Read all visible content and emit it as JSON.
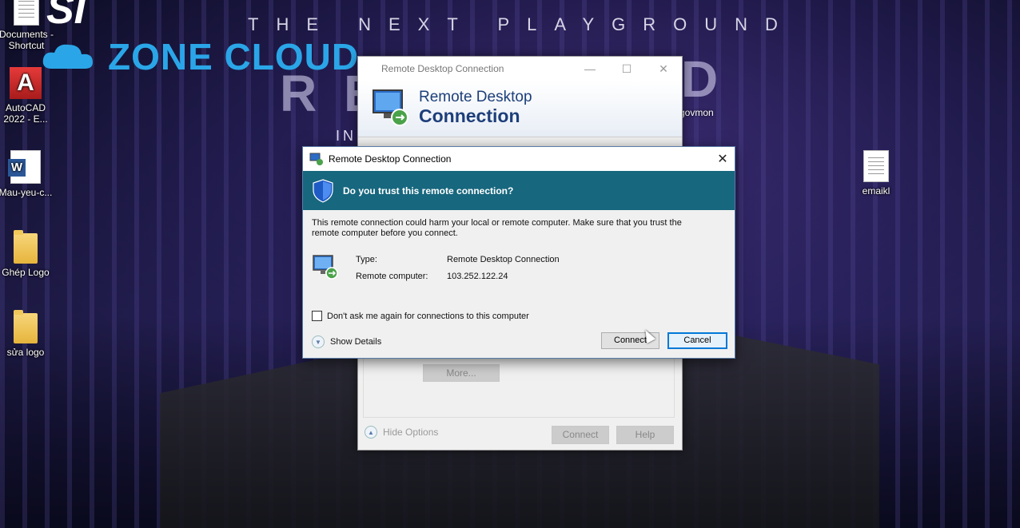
{
  "wallpaper": {
    "tagline": "THE NEXT PLAYGROUND",
    "brand_overlay": "ZONE CLOUD",
    "msi_logo": "SI",
    "big_letters": "R E",
    "big_letter_d": "D",
    "in_text": "IN",
    "govmon_label": "govmon"
  },
  "desktop_icons": [
    {
      "label": "Documents - Shortcut",
      "icon": "document-shortcut-icon"
    },
    {
      "label": "AutoCAD 2022 - E...",
      "icon": "autocad-icon"
    },
    {
      "label": "Mau-yeu-c...",
      "icon": "word-document-icon"
    },
    {
      "label": "Ghép Logo",
      "icon": "folder-icon"
    },
    {
      "label": "sửa logo",
      "icon": "folder-icon"
    },
    {
      "label": "emaikl",
      "icon": "text-file-icon"
    }
  ],
  "back_window": {
    "title": "Remote Desktop Connection",
    "header_line1": "Remote Desktop",
    "header_line2": "Connection",
    "more_button": "More...",
    "hide_options": "Hide Options",
    "connect_button": "Connect",
    "help_button": "Help",
    "minimize_glyph": "—",
    "maximize_glyph": "☐",
    "close_glyph": "✕"
  },
  "dialog": {
    "title": "Remote Desktop Connection",
    "close_glyph": "✕",
    "banner_text": "Do you trust this remote connection?",
    "warning": "This remote connection could harm your local or remote computer. Make sure that you trust the remote computer before you connect.",
    "type_label": "Type:",
    "type_value": "Remote Desktop Connection",
    "remote_label": "Remote computer:",
    "remote_value": "103.252.122.24",
    "dont_ask_label": "Don't ask me again for connections to this computer",
    "dont_ask_checked": false,
    "show_details": "Show Details",
    "connect_button": "Connect",
    "cancel_button": "Cancel"
  },
  "colors": {
    "banner": "#17677e",
    "title_text": "#1d3f7a",
    "primary_border": "#0078d7"
  }
}
